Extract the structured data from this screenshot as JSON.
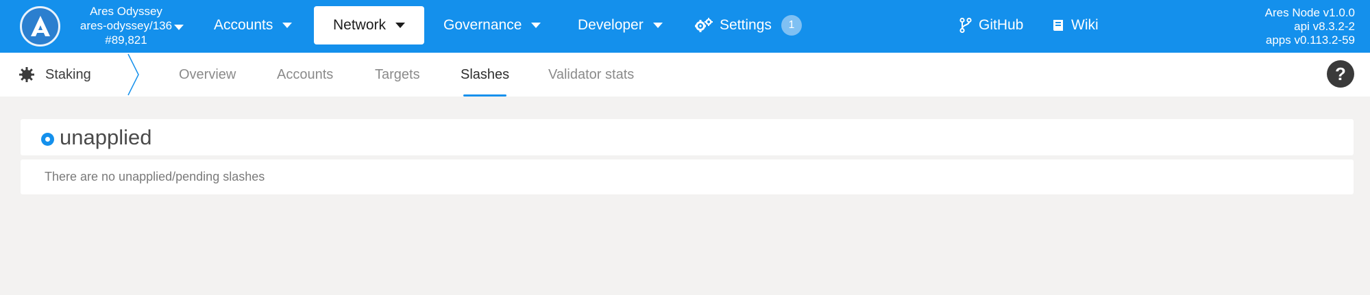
{
  "topbar": {
    "chain": {
      "name": "Ares Odyssey",
      "runtime": "ares-odyssey/136",
      "block": "#89,821"
    },
    "menus": [
      {
        "label": "Accounts"
      },
      {
        "label": "Network"
      },
      {
        "label": "Governance"
      },
      {
        "label": "Developer"
      },
      {
        "label": "Settings",
        "badge": "1"
      }
    ],
    "links": [
      {
        "label": "GitHub",
        "icon": "branch-icon"
      },
      {
        "label": "Wiki",
        "icon": "book-icon"
      }
    ],
    "node": {
      "name": "Ares Node v1.0.0",
      "api": "api v8.3.2-2",
      "apps": "apps v0.113.2-59"
    }
  },
  "subnav": {
    "section": "Staking",
    "tabs": [
      {
        "label": "Overview"
      },
      {
        "label": "Accounts"
      },
      {
        "label": "Targets"
      },
      {
        "label": "Slashes",
        "active": true
      },
      {
        "label": "Validator stats"
      }
    ],
    "help": "?"
  },
  "content": {
    "header": "unapplied",
    "empty_message": "There are no unapplied/pending slashes"
  },
  "colors": {
    "accent": "#1490ec",
    "background": "#f3f2f1"
  }
}
